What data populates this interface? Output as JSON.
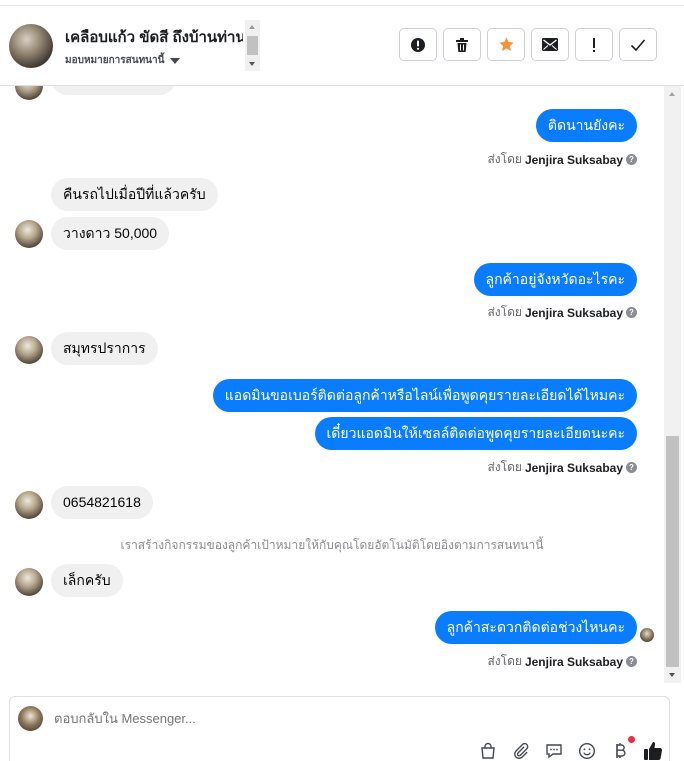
{
  "header": {
    "title": "เคลือบแก้ว ขัดสี ถึงบ้านท่าน",
    "assign_label": "มอบหมายการสนทนานี้",
    "actions": [
      {
        "name": "report-button",
        "icon": "alert-circle-icon"
      },
      {
        "name": "delete-button",
        "icon": "trash-icon"
      },
      {
        "name": "star-button",
        "icon": "star-icon"
      },
      {
        "name": "mark-unread-button",
        "icon": "envelope-icon"
      },
      {
        "name": "important-button",
        "icon": "exclamation-icon"
      },
      {
        "name": "done-button",
        "icon": "check-icon"
      }
    ]
  },
  "messages": {
    "out1": "ติดนานยังคะ",
    "in1": "คืนรถไปเมื่อปีที่แล้วครับ",
    "in2": "วางดาว 50,000",
    "out2": "ลูกค้าอยู่จังหวัดอะไรคะ",
    "in3": "สมุทรปราการ",
    "out3": "แอดมินขอเบอร์ติดต่อลูกค้าหรือไลน์เพื่อพูดคุยรายละเอียดได้ไหมคะ",
    "out4": "เดี๋ยวแอดมินให้เซลล์ติดต่อพูดคุยรายละเอียดนะคะ",
    "in4": "0654821618",
    "system_note": "เราสร้างกิจกรรมของลูกค้าเป้าหมายให้กับคุณโดยอัตโนมัติโดยอิงตามการสนทนานี้",
    "in5": "เล็กครับ",
    "out5": "ลูกค้าสะดวกติดต่อช่วงไหนคะ"
  },
  "sent_by": {
    "prefix": "ส่งโดย",
    "name": "Jenjira Suksabay"
  },
  "composer": {
    "placeholder": "ตอบกลับใน Messenger..."
  },
  "colors": {
    "outgoing_bubble": "#0a7cff",
    "incoming_bubble": "#f0f0f0",
    "star": "#f7923b",
    "like": "#1c1e21"
  }
}
